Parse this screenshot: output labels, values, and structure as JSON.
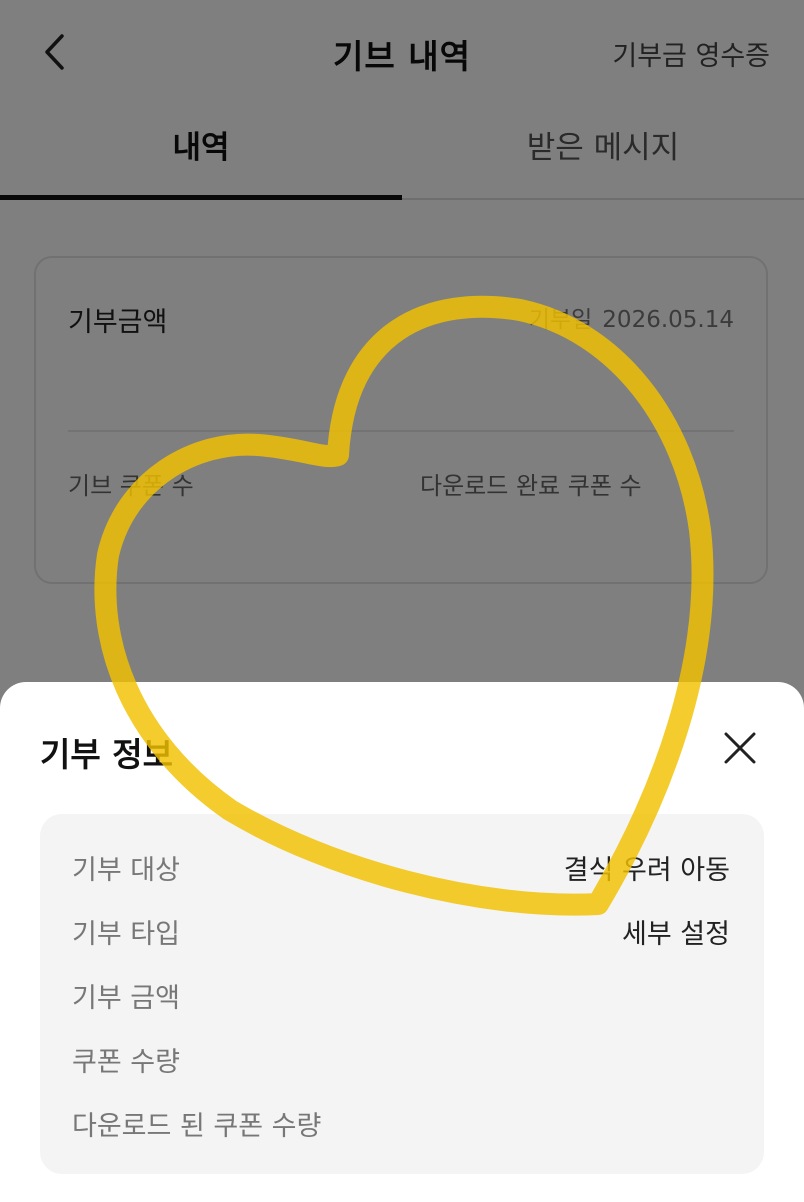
{
  "header": {
    "title": "기브 내역",
    "receipt_label": "기부금 영수증"
  },
  "tabs": [
    {
      "label": "내역",
      "active": true
    },
    {
      "label": "받은 메시지",
      "active": false
    }
  ],
  "card": {
    "amount_label": "기부금액",
    "date_label": "기부일",
    "date_value": "2026.05.14",
    "coupon_count_label": "기브 쿠폰 수",
    "download_count_label": "다운로드 완료 쿠폰 수"
  },
  "sheet": {
    "title": "기부 정보",
    "rows": [
      {
        "label": "기부 대상",
        "value": "결식 우려 아동"
      },
      {
        "label": "기부 타입",
        "value": "세부 설정"
      },
      {
        "label": "기부 금액",
        "value": ""
      },
      {
        "label": "쿠폰 수량",
        "value": ""
      },
      {
        "label": "다운로드 된 쿠폰 수량",
        "value": ""
      }
    ]
  },
  "colors": {
    "overlay": "#000000",
    "heart_stroke": "#F2C100",
    "sheet_background": "#ffffff",
    "info_box_background": "#f4f4f4"
  },
  "icons": {
    "back": "chevron-left-icon",
    "close": "close-icon"
  }
}
